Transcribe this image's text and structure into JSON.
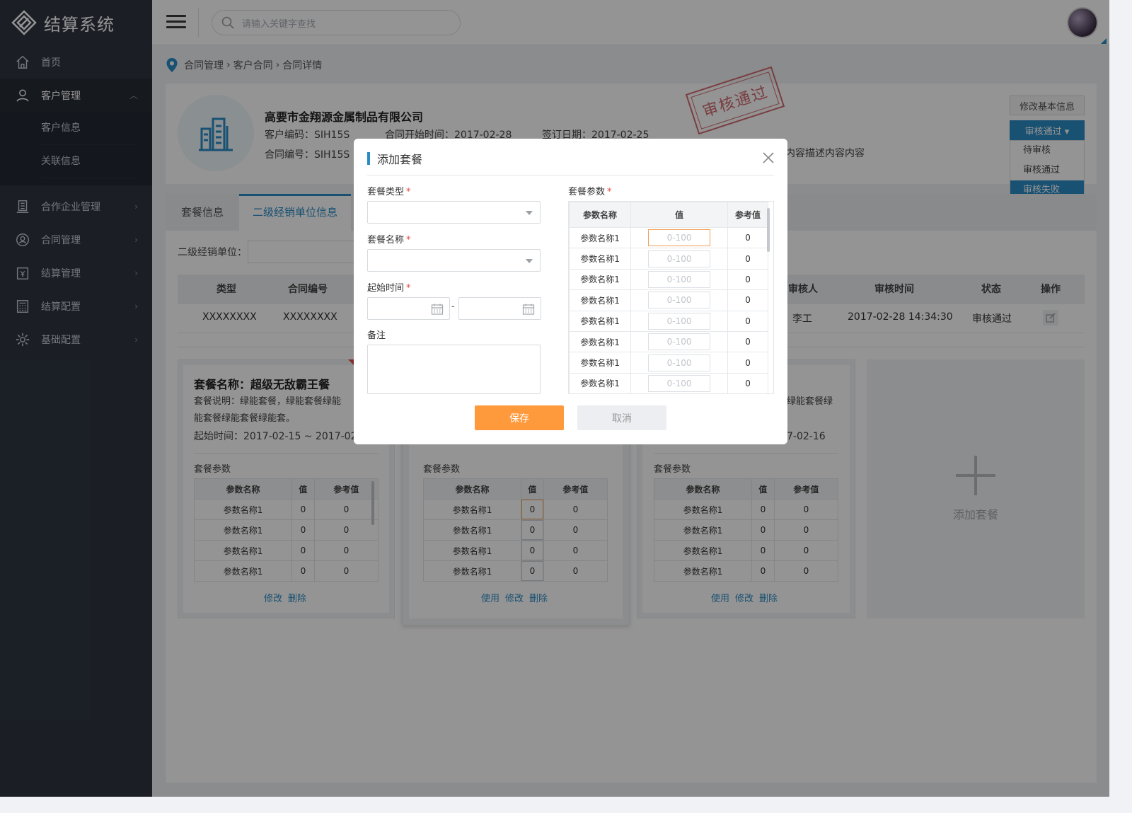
{
  "app": {
    "title": "结算系统"
  },
  "header": {
    "search_placeholder": "请输入关键字查找"
  },
  "sidebar": {
    "items": [
      {
        "label": "首页"
      },
      {
        "label": "客户管理"
      },
      {
        "label": "合作企业管理"
      },
      {
        "label": "合同管理"
      },
      {
        "label": "结算管理"
      },
      {
        "label": "结算配置"
      },
      {
        "label": "基础配置"
      }
    ],
    "sub_items": [
      {
        "label": "客户信息"
      },
      {
        "label": "关联信息"
      }
    ]
  },
  "breadcrumb": {
    "l1": "合同管理",
    "l2": "客户合同",
    "l3": "合同详情",
    "sep": "›"
  },
  "company": {
    "name": "高要市金翔源金属制品有限公司",
    "customer_code": "客户编码：SIH15S",
    "contract_no": "合同编号：SIH15S",
    "start_time": "合同开始时间：2017-02-28",
    "sign_date": "签订日期：2017-02-25",
    "desc": "内容描述内容内容",
    "stamp": "审核通过"
  },
  "actions": {
    "edit_basic": "修改基本信息",
    "status_btn": "审核通过 ▾",
    "options": [
      "待审核",
      "审核通过",
      "审核失败"
    ]
  },
  "tabs": [
    {
      "label": "套餐信息"
    },
    {
      "label": "二级经销单位信息"
    }
  ],
  "filter": {
    "label": "二级经销单位："
  },
  "table": {
    "headers": {
      "type": "类型",
      "contract_no": "合同编号",
      "auditor": "审核人",
      "audit_time": "审核时间",
      "status": "状态",
      "op": "操作"
    },
    "row": {
      "type": "XXXXXXXX",
      "contract_no": "XXXXXXXX",
      "auditor": "李工",
      "audit_time": "2017-02-28 14:34:30",
      "status": "审核通过"
    }
  },
  "packages": {
    "p1": {
      "title": "套餐名称：超级无敌霸王餐",
      "desc_line1": "套餐说明：绿能套餐，绿能套餐绿能",
      "desc_line2": "能套餐绿能套餐绿能套。",
      "time": "起始时间：2017-02-15 ~ 2017-02-1",
      "params_label": "套餐参数",
      "link1": "修改",
      "link2": "删除"
    },
    "p2": {
      "params_label": "套餐参数",
      "link1": "使用",
      "link2": "修改",
      "link3": "删除"
    },
    "p3": {
      "desc_tail": "绿能套餐绿",
      "time_tail": "7-02-16",
      "params_label": "套餐参数",
      "link1": "使用",
      "link2": "修改",
      "link3": "删除"
    },
    "param_headers": {
      "name": "参数名称",
      "value": "值",
      "ref": "参考值"
    },
    "param_row": {
      "name": "参数名称1",
      "value": "0",
      "ref": "0"
    },
    "add_label": "添加套餐"
  },
  "modal": {
    "title": "添加套餐",
    "type_label": "套餐类型",
    "name_label": "套餐名称",
    "time_label": "起始时间",
    "time_sep": "-",
    "note_label": "备注",
    "params_label": "套餐参数",
    "required_mark": "*",
    "param_headers": {
      "name": "参数名称",
      "value": "值",
      "ref": "参考值"
    },
    "param_rows": [
      {
        "name": "参数名称1",
        "placeholder": "0-100",
        "ref": "0"
      },
      {
        "name": "参数名称1",
        "placeholder": "0-100",
        "ref": "0"
      },
      {
        "name": "参数名称1",
        "placeholder": "0-100",
        "ref": "0"
      },
      {
        "name": "参数名称1",
        "placeholder": "0-100",
        "ref": "0"
      },
      {
        "name": "参数名称1",
        "placeholder": "0-100",
        "ref": "0"
      },
      {
        "name": "参数名称1",
        "placeholder": "0-100",
        "ref": "0"
      },
      {
        "name": "参数名称1",
        "placeholder": "0-100",
        "ref": "0"
      },
      {
        "name": "参数名称1",
        "placeholder": "0-100",
        "ref": "0"
      }
    ],
    "save": "保存",
    "cancel": "取消"
  },
  "colors": {
    "accent": "#2b8cc4",
    "save": "#ff9a3c",
    "sidebar": "#2f3541",
    "stamp": "#d26b71"
  }
}
